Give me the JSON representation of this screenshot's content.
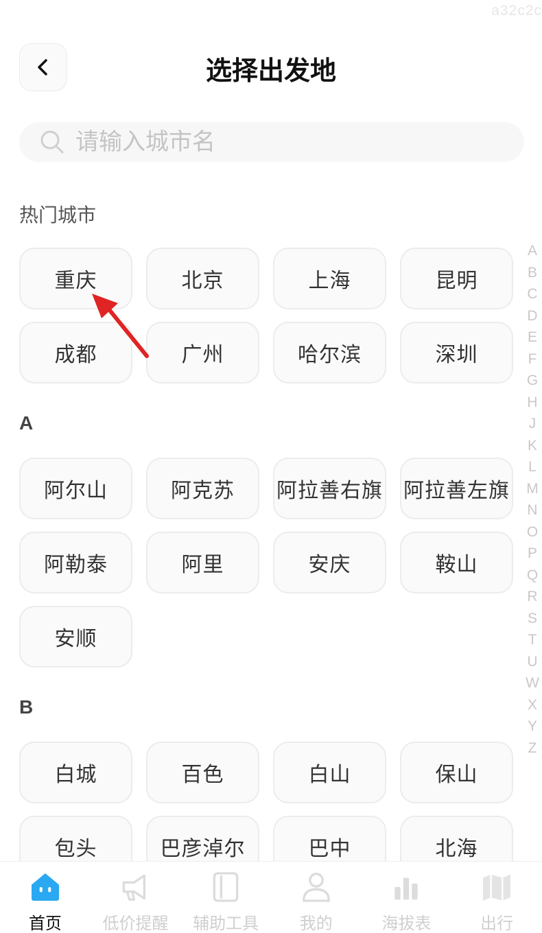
{
  "watermark": "a32c2c",
  "header": {
    "title": "选择出发地",
    "back_icon": "chevron-left-icon"
  },
  "search": {
    "placeholder": "请输入城市名",
    "value": "",
    "icon": "search-icon"
  },
  "hot": {
    "title": "热门城市",
    "cities": [
      "重庆",
      "北京",
      "上海",
      "昆明",
      "成都",
      "广州",
      "哈尔滨",
      "深圳"
    ]
  },
  "sections": [
    {
      "letter": "A",
      "cities": [
        "阿尔山",
        "阿克苏",
        "阿拉善右旗",
        "阿拉善左旗",
        "阿勒泰",
        "阿里",
        "安庆",
        "鞍山",
        "安顺"
      ]
    },
    {
      "letter": "B",
      "cities": [
        "白城",
        "百色",
        "白山",
        "保山",
        "包头",
        "巴彦淖尔",
        "巴中",
        "北海"
      ]
    }
  ],
  "alphabet_index": [
    "A",
    "B",
    "C",
    "D",
    "E",
    "F",
    "G",
    "H",
    "J",
    "K",
    "L",
    "M",
    "N",
    "O",
    "P",
    "Q",
    "R",
    "S",
    "T",
    "U",
    "W",
    "X",
    "Y",
    "Z"
  ],
  "annotation": {
    "arrow_color": "#e02424",
    "points_to": "重庆"
  },
  "tabbar": {
    "active_color": "#2aa8f2",
    "items": [
      {
        "label": "首页",
        "icon": "home-face-icon",
        "active": true
      },
      {
        "label": "低价提醒",
        "icon": "megaphone-icon",
        "active": false
      },
      {
        "label": "辅助工具",
        "icon": "tool-panel-icon",
        "active": false
      },
      {
        "label": "我的",
        "icon": "user-icon",
        "active": false
      },
      {
        "label": "海拔表",
        "icon": "bar-chart-icon",
        "active": false
      },
      {
        "label": "出行",
        "icon": "map-icon",
        "active": false
      }
    ]
  }
}
